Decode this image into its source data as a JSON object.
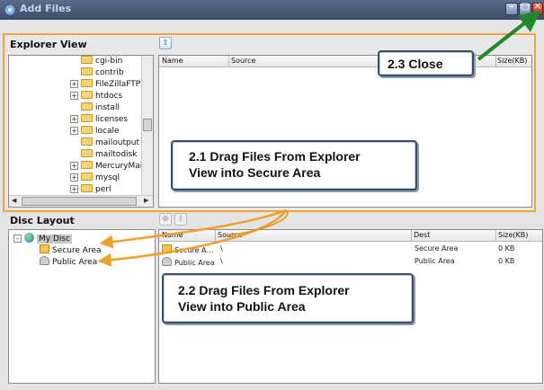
{
  "window": {
    "title": "Add Files"
  },
  "explorer": {
    "label": "Explorer View",
    "tree_items": [
      "cgi-bin",
      "contrib",
      "FileZillaFTP",
      "htdocs",
      "install",
      "licenses",
      "locale",
      "mailoutput",
      "mailtodisk",
      "MercuryMail",
      "mysql",
      "perl"
    ],
    "columns": [
      "Name",
      "Source",
      "Size(KB)"
    ]
  },
  "disc": {
    "label": "Disc Layout",
    "root": "My Disc",
    "areas": [
      "Secure Area",
      "Public Area"
    ],
    "columns": [
      "Name",
      "Source",
      "Dest",
      "Size(KB)"
    ],
    "rows": [
      {
        "name": "Secure A…",
        "source": "\\",
        "dest": "Secure Area",
        "size": "0 KB"
      },
      {
        "name": "Public Area",
        "source": "\\",
        "dest": "Public Area",
        "size": "0 KB"
      }
    ]
  },
  "callouts": {
    "close": "2.3 Close",
    "secure_line1": "2.1 Drag Files From Explorer",
    "secure_line2": "View into Secure Area",
    "public_line1": "2.2 Drag Files From Explorer",
    "public_line2": "View into Public Area"
  },
  "colors": {
    "highlight": "#f2a33a",
    "arrow_green": "#1f8a2a",
    "arrow_orange": "#f0a02a"
  }
}
